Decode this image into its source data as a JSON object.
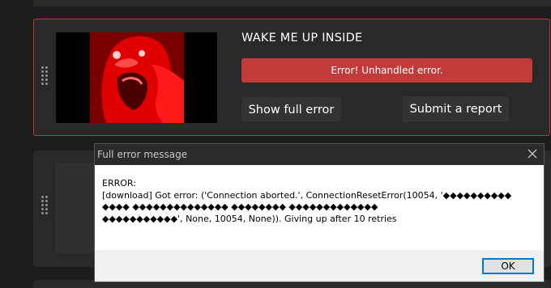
{
  "item1": {
    "title": "WAKE ME UP INSIDE",
    "error_label": "Error! Unhandled error.",
    "show_full_error": "Show full error",
    "submit_report": "Submit a report"
  },
  "dialog": {
    "title": "Full error message",
    "message": "ERROR:\n[download] Got error: ('Connection aborted.', ConnectionResetError(10054, '◆◆◆◆◆◆◆◆◆◆\n◆◆◆◆ ◆◆◆◆◆◆◆◆◆◆◆◆◆◆ ◆◆◆◆◆◆◆◆ ◆◆◆◆◆◆◆◆◆◆◆◆◆\n◆◆◆◆◆◆◆◆◆◆◆', None, 10054, None)). Giving up after 10 retries",
    "ok_label": "OK"
  },
  "colors": {
    "error_accent": "#c23a3a",
    "card_border": "#b83a3a",
    "background": "#1c1c1c",
    "card": "#292929"
  }
}
